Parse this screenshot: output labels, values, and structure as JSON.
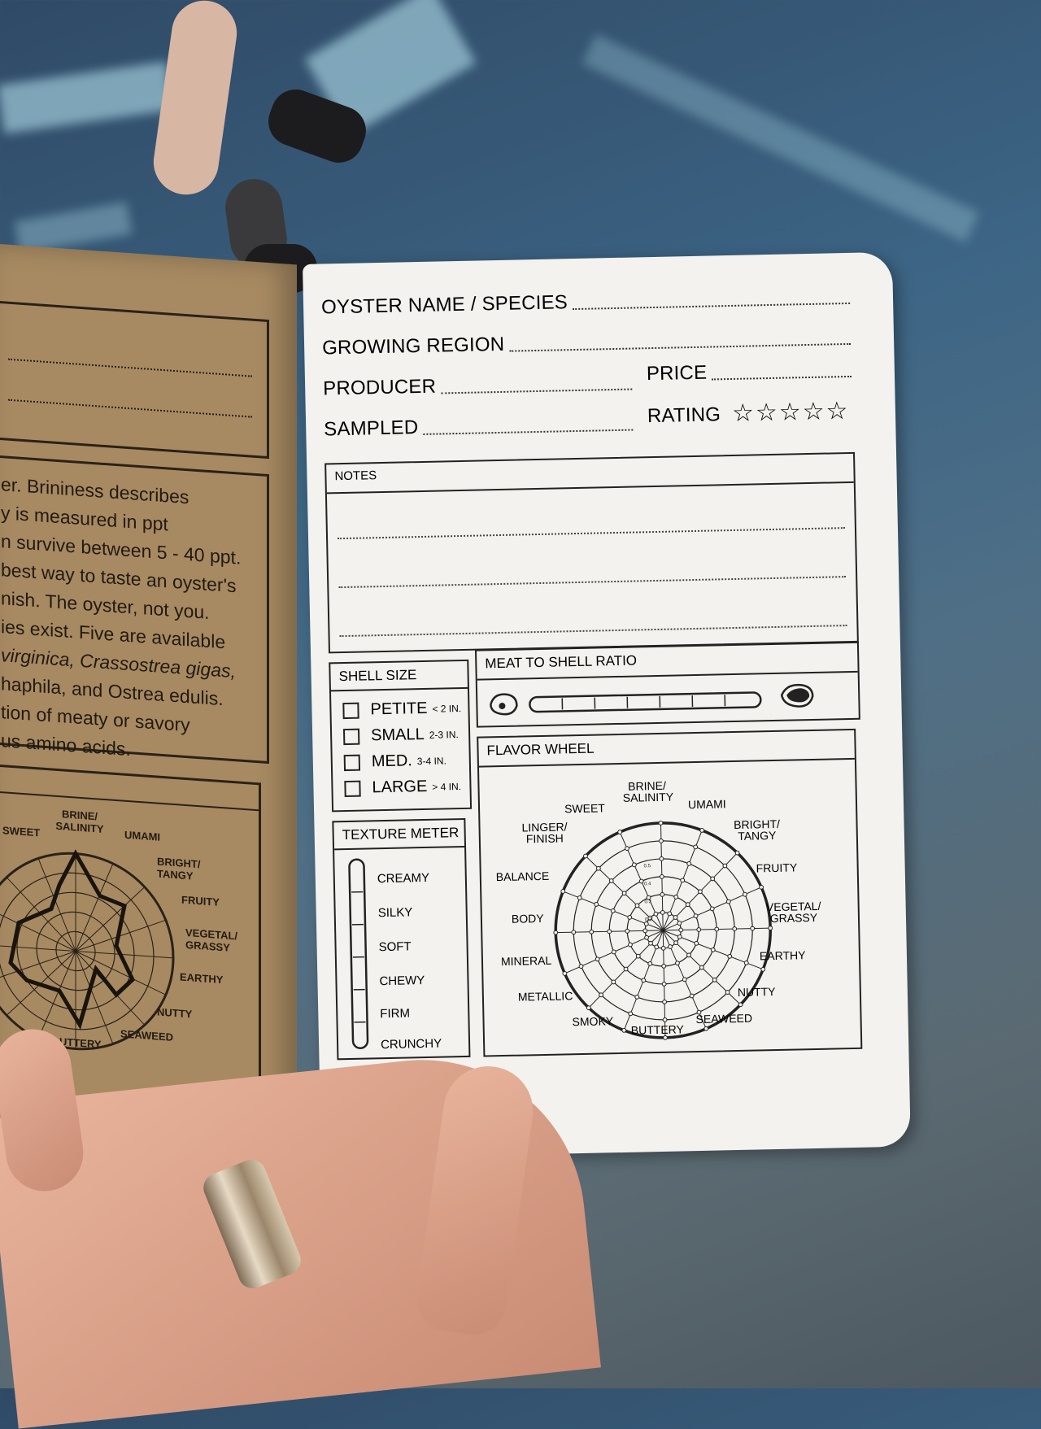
{
  "left_page": {
    "text_lines": [
      "er. Brininess describes",
      "y is measured in ppt",
      "n survive between 5 - 40 ppt.",
      "best way to taste an oyster's",
      "nish. The oyster, not you.",
      "ies exist. Five are available",
      "virginica, Crassostrea gigas,",
      "haphila, and Ostrea edulis.",
      "tion of meaty or savory",
      "us amino acids."
    ],
    "wheel_labels": [
      "BRINE/ SALINITY",
      "SWEET",
      "UMAMI",
      "BRIGHT/ TANGY",
      "FRUITY",
      "VEGETAL/ GRASSY",
      "EARTHY",
      "NUTTY",
      "SEAWEED",
      "UTTERY"
    ]
  },
  "card": {
    "fields": {
      "oyster_name": "OYSTER NAME / SPECIES",
      "growing_region": "GROWING REGION",
      "producer": "PRODUCER",
      "price": "PRICE",
      "sampled": "SAMPLED",
      "rating": "RATING"
    },
    "rating_stars": "☆☆☆☆☆",
    "notes_title": "NOTES",
    "shell_size": {
      "title": "SHELL SIZE",
      "options": [
        {
          "label": "PETITE",
          "sub": "< 2 IN."
        },
        {
          "label": "SMALL",
          "sub": "2-3 IN."
        },
        {
          "label": "MED.",
          "sub": "3-4 IN."
        },
        {
          "label": "LARGE",
          "sub": "> 4 IN."
        }
      ]
    },
    "meat_ratio": {
      "title": "MEAT TO SHELL RATIO"
    },
    "texture_meter": {
      "title": "TEXTURE METER",
      "levels": [
        "CREAMY",
        "SILKY",
        "SOFT",
        "CHEWY",
        "FIRM",
        "CRUNCHY"
      ]
    },
    "flavor_wheel": {
      "title": "FLAVOR WHEEL",
      "labels": {
        "brine": "BRINE/ SALINITY",
        "umami": "UMAMI",
        "bright": "BRIGHT/ TANGY",
        "fruity": "FRUITY",
        "vegetal": "VEGETAL/ GRASSY",
        "earthy": "EARTHY",
        "nutty": "NUTTY",
        "seaweed": "SEAWEED",
        "buttery": "BUTTERY",
        "smoky": "SMOKY",
        "metallic": "METALLIC",
        "mineral": "MINERAL",
        "body": "BODY",
        "balance": "BALANCE",
        "linger": "LINGER/ FINISH",
        "sweet": "SWEET"
      },
      "scale": [
        "0.5",
        "0.4",
        "0.3",
        "0.2"
      ]
    }
  }
}
